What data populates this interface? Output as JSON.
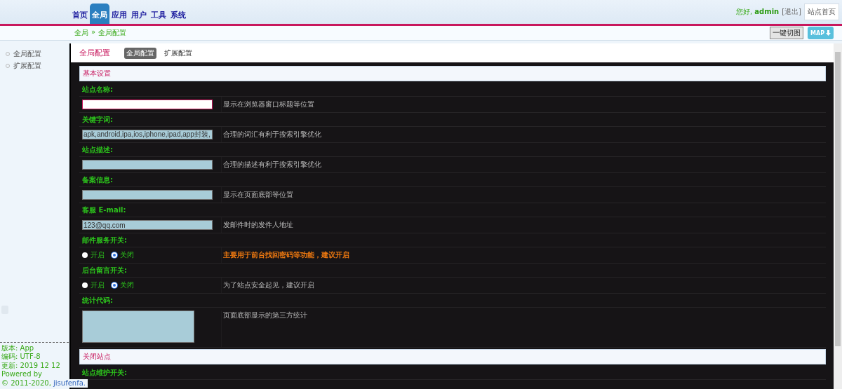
{
  "header": {
    "nav": [
      {
        "label": "首页",
        "selected": false
      },
      {
        "label": "全局",
        "selected": true
      },
      {
        "label": "应用",
        "selected": false
      },
      {
        "label": "用户",
        "selected": false
      },
      {
        "label": "工具",
        "selected": false
      },
      {
        "label": "系统",
        "selected": false
      }
    ],
    "greeting": "您好,",
    "username": "admin",
    "logout": "[退出]",
    "home_button": "站点首页"
  },
  "breadcrumb": {
    "items": [
      "全局",
      "全局配置"
    ],
    "separator": "»"
  },
  "toolbar": {
    "cut_button": "一键切图",
    "map_button": "MAP"
  },
  "sidebar": {
    "items": [
      {
        "label": "全局配置"
      },
      {
        "label": "扩展配置"
      }
    ],
    "footer": [
      {
        "kind": "text",
        "text": "版本: App"
      },
      {
        "kind": "text",
        "text": "编码: UTF-8"
      },
      {
        "kind": "text",
        "text": "更新: 2019 12 12"
      },
      {
        "kind": "text",
        "text": "Powered by"
      },
      {
        "kind": "link",
        "text": "© 2011-2020, ",
        "link": "jisufenfa."
      }
    ]
  },
  "panel": {
    "title": "全局配置",
    "tabs": [
      {
        "label": "全局配置",
        "selected": true
      },
      {
        "label": "扩展配置",
        "selected": false
      }
    ],
    "sections": [
      {
        "title": "基本设置",
        "settings": [
          {
            "kind": "text",
            "label": "站点名称:",
            "focused": true,
            "hint": "显示在浏览器窗口标题等位置",
            "warning": false
          },
          {
            "kind": "text",
            "label": "关键字词:",
            "focused": false,
            "value": "apk,android,ipa,ios,iphone,ipad,app封装,",
            "hint": "合理的词汇有利于搜索引擎优化",
            "warning": false
          },
          {
            "kind": "text",
            "label": "站点描述:",
            "focused": false,
            "hint": "合理的描述有利于搜索引擎优化",
            "warning": false
          },
          {
            "kind": "text",
            "label": "备案信息:",
            "focused": false,
            "hint": "显示在页面底部等位置",
            "warning": false
          },
          {
            "kind": "text",
            "label": "客服 E-mail:",
            "focused": false,
            "value": "123@qq.com",
            "hint": "发邮件时的发件人地址",
            "warning": false
          },
          {
            "kind": "radio",
            "label": "邮件服务开关:",
            "options": [
              {
                "label": "开启",
                "selected": false
              },
              {
                "label": "关闭",
                "selected": true
              }
            ],
            "hint": "主要用于前台找回密码等功能，建议开启",
            "warning": true
          },
          {
            "kind": "radio",
            "label": "后台留言开关:",
            "options": [
              {
                "label": "开启",
                "selected": false
              },
              {
                "label": "关闭",
                "selected": true
              }
            ],
            "hint": "为了站点安全起见，建议开启",
            "warning": false
          },
          {
            "kind": "textarea",
            "label": "统计代码:",
            "focused": false,
            "hint": "页面底部显示的第三方统计",
            "warning": false
          }
        ]
      },
      {
        "title": "关闭站点",
        "settings": [
          {
            "label": "站点维护开关:"
          }
        ]
      }
    ]
  }
}
